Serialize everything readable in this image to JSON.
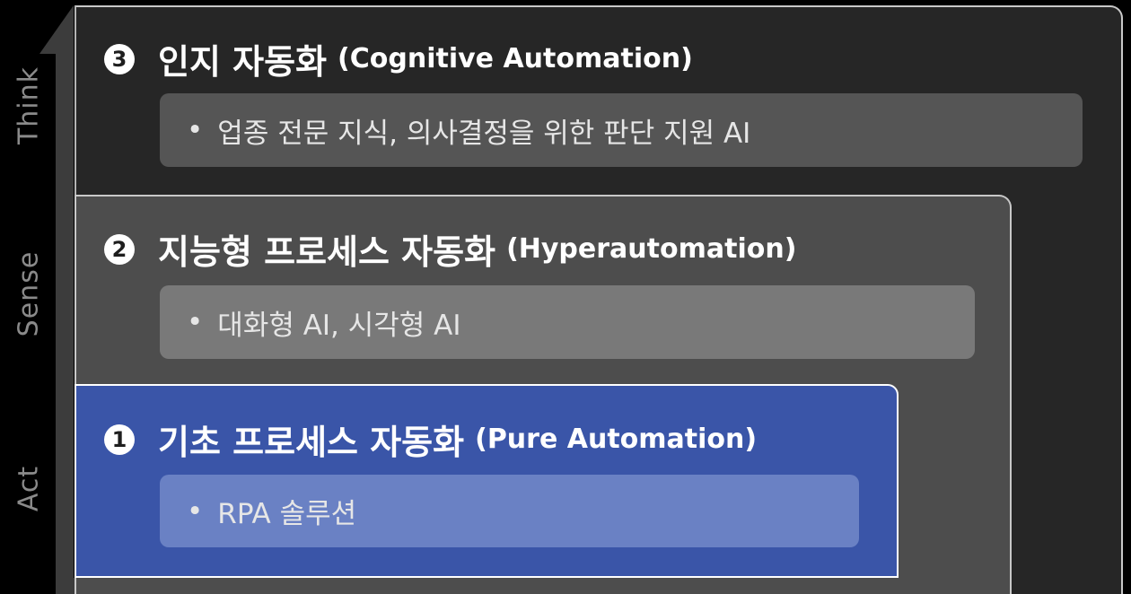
{
  "axis": {
    "labels": [
      "Think",
      "Sense",
      "Act"
    ]
  },
  "levels": [
    {
      "number": "3",
      "title_ko": "인지 자동화",
      "title_en": "(Cognitive Automation)",
      "bullet": "•",
      "content": "업종 전문 지식, 의사결정을 위한 판단 지원 AI",
      "color": "#262626"
    },
    {
      "number": "2",
      "title_ko": "지능형 프로세스 자동화",
      "title_en": "(Hyperautomation)",
      "bullet": "•",
      "content": "대화형 AI, 시각형 AI",
      "color": "#4d4d4d"
    },
    {
      "number": "1",
      "title_ko": "기초 프로세스 자동화",
      "title_en": "(Pure Automation)",
      "bullet": "•",
      "content": "RPA 솔루션",
      "color": "#3a55a8"
    }
  ]
}
